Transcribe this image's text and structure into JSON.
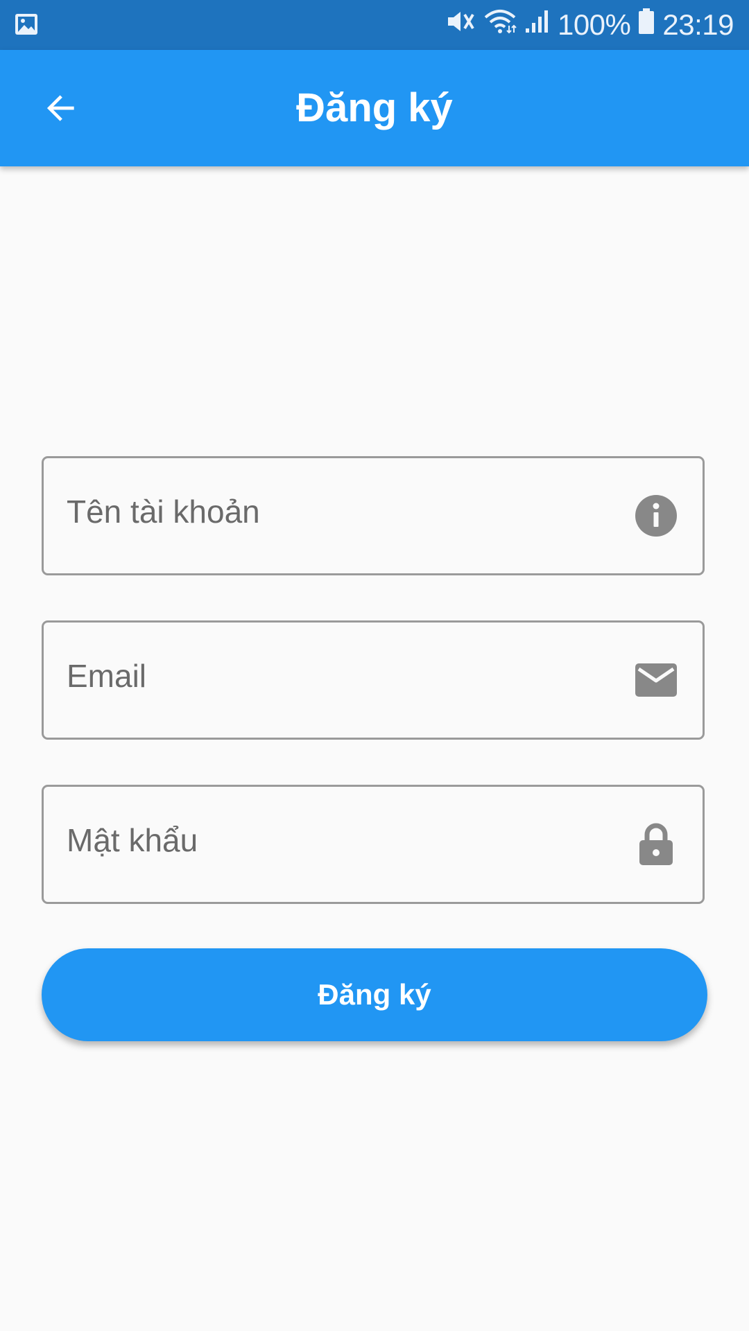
{
  "status_bar": {
    "battery": "100%",
    "time": "23:19",
    "icons": [
      "gallery-notification-icon",
      "vibrate-mute-icon",
      "wifi-icon",
      "cell-signal-icon",
      "battery-icon"
    ]
  },
  "app_bar": {
    "title": "Đăng ký",
    "back_icon": "arrow-back-icon",
    "background": "#2196f3"
  },
  "form": {
    "username": {
      "placeholder": "Tên tài khoản",
      "value": "",
      "icon": "info-icon"
    },
    "email": {
      "placeholder": "Email",
      "value": "",
      "icon": "mail-icon"
    },
    "password": {
      "placeholder": "Mật khẩu",
      "value": "",
      "icon": "lock-icon"
    }
  },
  "submit": {
    "label": "Đăng ký",
    "color": "#2196f3"
  },
  "colors": {
    "status_bar": "#1e73be",
    "primary": "#2196f3",
    "field_border": "#9a9a9a",
    "icon_gray": "#888888",
    "background": "#fafafa"
  }
}
